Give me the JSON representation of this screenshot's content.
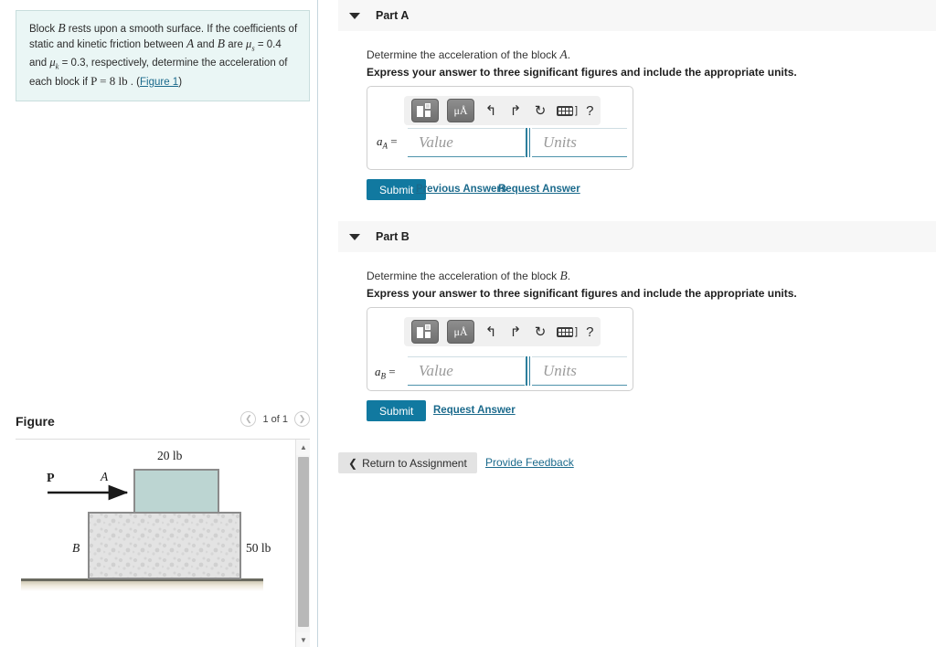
{
  "problem": {
    "line1_a": "Block ",
    "var_B": "B",
    "line1_b": " rests upon a smooth surface. If the coefficients of",
    "line2_a": "static and kinetic friction between ",
    "var_A": "A",
    "line2_b": " and ",
    "line2_c": " are ",
    "mu_s": "μ",
    "mu_s_sub": "s",
    "mu_s_val": " = 0.4 and",
    "mu_k": "μ",
    "mu_k_sub": "k",
    "mu_k_val": " = 0.3, respectively, determine the acceleration of each block",
    "line4_a": "if ",
    "var_P": "P",
    "line4_b": " = 8 lb",
    "line4_c": " . (",
    "figure_link": "Figure 1",
    "line4_d": ")"
  },
  "figure_panel": {
    "title": "Figure",
    "prev_icon": "chevron-left-icon",
    "next_icon": "chevron-right-icon",
    "counter": "1 of 1",
    "scroll_up_icon": "▲",
    "scroll_down_icon": "▼",
    "diagram": {
      "force_label": "P",
      "block_a_label": "A",
      "block_a_weight": "20 lb",
      "block_b_label": "B",
      "block_b_weight": "50 lb",
      "block_a_color": "#bcd5d2",
      "block_b_color": "#e3e3e3",
      "ground_color": "#ded9c8"
    }
  },
  "parts": [
    {
      "header": "Part A",
      "caret_icon": "caret-down-icon",
      "prompt_prefix": "Determine the acceleration of the block ",
      "prompt_var": "A",
      "prompt_suffix": ".",
      "instruction": "Express your answer to three significant figures and include the appropriate units.",
      "toolbar": {
        "templates_icon": "templates-grid-icon",
        "units_label": "μÅ",
        "units_icon": "micro-angstrom-icon",
        "undo_icon": "undo-arrow-icon",
        "undo_glyph": "↰",
        "redo_icon": "redo-arrow-icon",
        "redo_glyph": "↱",
        "reset_icon": "reset-circular-arrow-icon",
        "reset_glyph": "↻",
        "keyboard_icon": "keyboard-icon",
        "keyboard_bracket": "]",
        "help_icon": "help-question-icon",
        "help_glyph": "?"
      },
      "variable": "a",
      "variable_sub": "A",
      "equals": "=",
      "value_placeholder": "Value",
      "units_placeholder": "Units",
      "submit_label": "Submit",
      "previous_answers_label": "Previous Answers",
      "request_answer_label": "Request Answer"
    },
    {
      "header": "Part B",
      "caret_icon": "caret-down-icon",
      "prompt_prefix": "Determine the acceleration of the block ",
      "prompt_var": "B",
      "prompt_suffix": ".",
      "instruction": "Express your answer to three significant figures and include the appropriate units.",
      "toolbar": {
        "templates_icon": "templates-grid-icon",
        "units_label": "μÅ",
        "units_icon": "micro-angstrom-icon",
        "undo_icon": "undo-arrow-icon",
        "undo_glyph": "↰",
        "redo_icon": "redo-arrow-icon",
        "redo_glyph": "↱",
        "reset_icon": "reset-circular-arrow-icon",
        "reset_glyph": "↻",
        "keyboard_icon": "keyboard-icon",
        "keyboard_bracket": "]",
        "help_icon": "help-question-icon",
        "help_glyph": "?"
      },
      "variable": "a",
      "variable_sub": "B",
      "equals": "=",
      "value_placeholder": "Value",
      "units_placeholder": "Units",
      "submit_label": "Submit",
      "request_answer_label": "Request Answer"
    }
  ],
  "footer": {
    "return_icon": "chevron-left-icon",
    "return_glyph": "❮",
    "return_label": "Return to Assignment",
    "feedback_label": "Provide Feedback"
  },
  "colors": {
    "accent": "#1179a0",
    "link": "#1b6a8c",
    "problem_bg": "#eaf6f5",
    "part_header_bg": "#f7f7f7"
  }
}
